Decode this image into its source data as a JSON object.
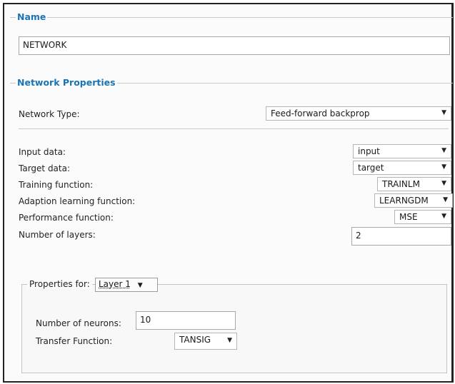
{
  "name_section": {
    "title": "Name",
    "value": "NETWORK"
  },
  "network_properties": {
    "title": "Network Properties",
    "network_type_label": "Network Type:",
    "network_type_value": "Feed-forward backprop",
    "input_data_label": "Input data:",
    "input_data_value": "input",
    "target_data_label": "Target data:",
    "target_data_value": "target",
    "training_function_label": "Training function:",
    "training_function_value": "TRAINLM",
    "adaption_function_label": "Adaption learning function:",
    "adaption_function_value": "LEARNGDM",
    "performance_function_label": "Performance function:",
    "performance_function_value": "MSE",
    "layers_label": "Number of layers:",
    "layers_value": "2"
  },
  "layer_properties": {
    "title": "Properties for:",
    "layer_value": "Layer 1",
    "neurons_label": "Number of neurons:",
    "neurons_value": "10",
    "transfer_label": "Transfer Function:",
    "transfer_value": "TANSIG"
  },
  "icons": {
    "dropdown": "▼"
  }
}
